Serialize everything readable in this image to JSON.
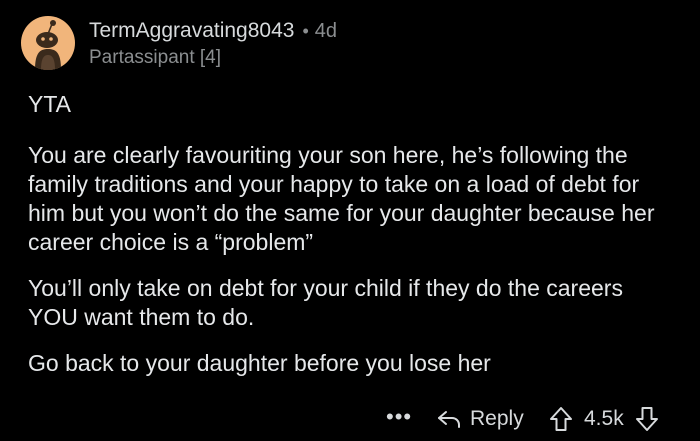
{
  "comment": {
    "username": "TermAggravating8043",
    "separator": "•",
    "age": "4d",
    "flair": "Partassipant [4]",
    "paragraphs": [
      "YTA",
      "You are clearly favouriting your son here, he’s following the family traditions and your happy to take on a load of debt for him but you won’t do the same for your daughter because her career choice is a “problem”",
      "You’ll only take on debt for your child if they do the careers YOU want them to do.",
      "Go back to your daughter before you lose her"
    ]
  },
  "actions": {
    "more_label": "•••",
    "reply_label": "Reply",
    "vote_count": "4.5k"
  },
  "icons": {
    "avatar": "snoo-avatar-icon",
    "reply": "reply-arrow-icon",
    "upvote": "upvote-arrow-icon",
    "downvote": "downvote-arrow-icon"
  },
  "colors": {
    "background": "#000000",
    "text": "#d7dadc",
    "meta": "#8b8e90",
    "avatar_bg": "#f1b57b"
  }
}
